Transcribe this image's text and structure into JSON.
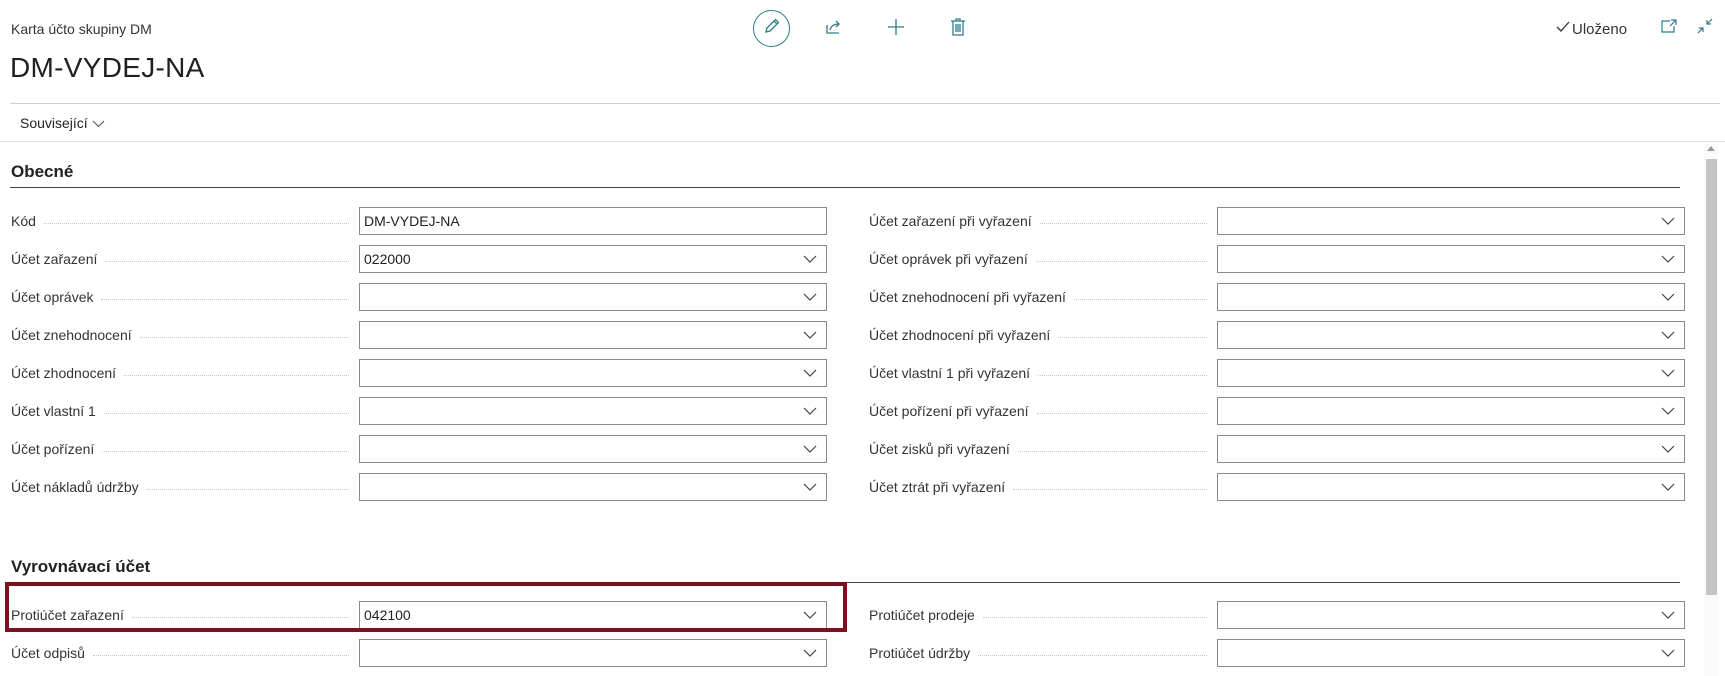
{
  "header": {
    "subtitle": "Karta účto skupiny DM",
    "title": "DM-VYDEJ-NA",
    "saved_label": "Uloženo",
    "icons": {
      "edit": "edit-pencil-icon",
      "share": "share-icon",
      "new": "plus-icon",
      "delete": "trash-icon",
      "saved": "checkmark-icon",
      "popout": "open-new-window-icon",
      "collapse": "collapse-icon"
    }
  },
  "menu": {
    "related_label": "Související"
  },
  "sections": [
    {
      "title": "Obecné",
      "left": [
        {
          "label": "Kód",
          "value": "DM-VYDEJ-NA",
          "dropdown": false
        },
        {
          "label": "Účet zařazení",
          "value": "022000",
          "dropdown": true
        },
        {
          "label": "Účet oprávek",
          "value": "",
          "dropdown": true
        },
        {
          "label": "Účet znehodnocení",
          "value": "",
          "dropdown": true
        },
        {
          "label": "Účet zhodnocení",
          "value": "",
          "dropdown": true
        },
        {
          "label": "Účet vlastní 1",
          "value": "",
          "dropdown": true
        },
        {
          "label": "Účet pořízení",
          "value": "",
          "dropdown": true
        },
        {
          "label": "Účet nákladů údržby",
          "value": "",
          "dropdown": true
        }
      ],
      "right": [
        {
          "label": "Účet zařazení při vyřazení",
          "value": "",
          "dropdown": true
        },
        {
          "label": "Účet oprávek při vyřazení",
          "value": "",
          "dropdown": true
        },
        {
          "label": "Účet znehodnocení při vyřazení",
          "value": "",
          "dropdown": true
        },
        {
          "label": "Účet zhodnocení při vyřazení",
          "value": "",
          "dropdown": true
        },
        {
          "label": "Účet vlastní 1 při vyřazení",
          "value": "",
          "dropdown": true
        },
        {
          "label": "Účet pořízení při vyřazení",
          "value": "",
          "dropdown": true
        },
        {
          "label": "Účet zisků při vyřazení",
          "value": "",
          "dropdown": true
        },
        {
          "label": "Účet ztrát při vyřazení",
          "value": "",
          "dropdown": true
        }
      ]
    },
    {
      "title": "Vyrovnávací účet",
      "left": [
        {
          "label": "Protiúčet zařazení",
          "value": "042100",
          "dropdown": true
        },
        {
          "label": "Účet odpisů",
          "value": "",
          "dropdown": true
        }
      ],
      "right": [
        {
          "label": "Protiúčet prodeje",
          "value": "",
          "dropdown": true
        },
        {
          "label": "Protiúčet údržby",
          "value": "",
          "dropdown": true
        }
      ]
    }
  ],
  "highlight_color": "#7a1120",
  "accent_color": "#2f7d8a"
}
